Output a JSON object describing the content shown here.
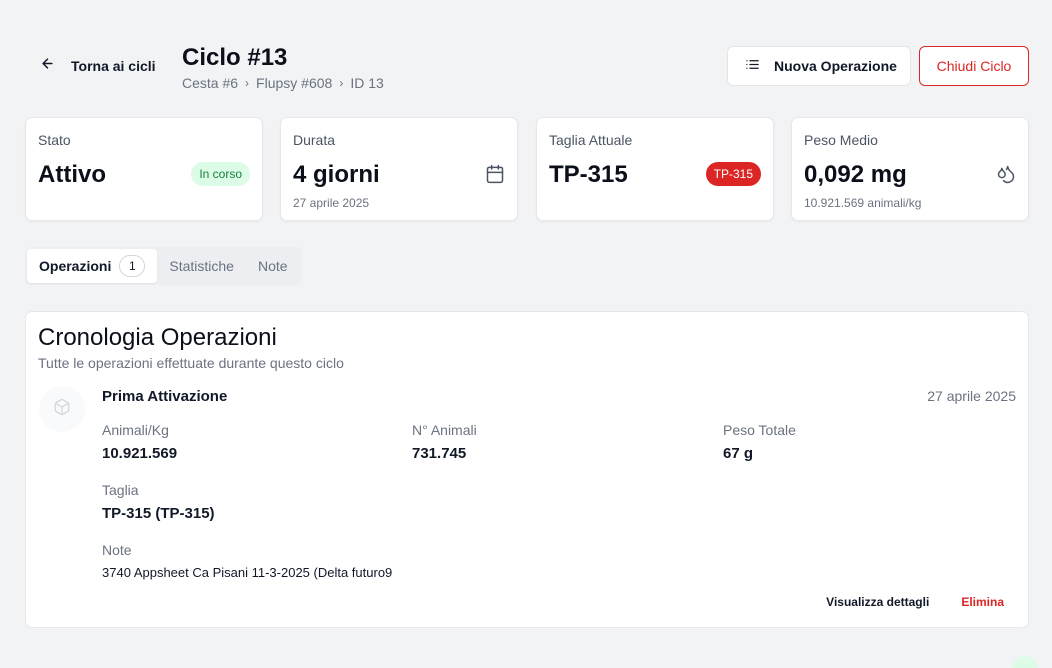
{
  "header": {
    "back_label": "Torna ai cicli",
    "title": "Ciclo #13",
    "breadcrumb": [
      "Cesta #6",
      "Flupsy #608",
      "ID 13"
    ],
    "new_operation_label": "Nuova Operazione",
    "close_cycle_label": "Chiudi Ciclo"
  },
  "cards": {
    "stato": {
      "label": "Stato",
      "value": "Attivo",
      "badge": "In corso"
    },
    "durata": {
      "label": "Durata",
      "value": "4 giorni",
      "sub": "27 aprile 2025",
      "icon": "calendar-icon"
    },
    "taglia": {
      "label": "Taglia Attuale",
      "value": "TP-315",
      "badge": "TP-315"
    },
    "peso": {
      "label": "Peso Medio",
      "value": "0,092 mg",
      "sub": "10.921.569 animali/kg",
      "icon": "droplets-icon"
    }
  },
  "tabs": [
    {
      "label": "Operazioni",
      "count": "1",
      "active": true
    },
    {
      "label": "Statistiche"
    },
    {
      "label": "Note"
    }
  ],
  "operations": {
    "title": "Cronologia Operazioni",
    "subtitle": "Tutte le operazioni effettuate durante questo ciclo",
    "items": [
      {
        "name": "Prima Attivazione",
        "date": "27 aprile 2025",
        "icon": "box-icon",
        "animali_kg_label": "Animali/Kg",
        "animali_kg": "10.921.569",
        "n_animali_label": "N° Animali",
        "n_animali": "731.745",
        "peso_totale_label": "Peso Totale",
        "peso_totale": "67 g",
        "taglia_label": "Taglia",
        "taglia": "TP-315 (TP-315)",
        "note_label": "Note",
        "note": "3740 Appsheet Ca Pisani 11-3-2025 (Delta futuro9",
        "details_label": "Visualizza dettagli",
        "delete_label": "Elimina"
      }
    ]
  },
  "colors": {
    "accent_red": "#dc2626",
    "success_bg": "#dcfce7",
    "success_text": "#15803d",
    "background": "#f2f3f5"
  }
}
